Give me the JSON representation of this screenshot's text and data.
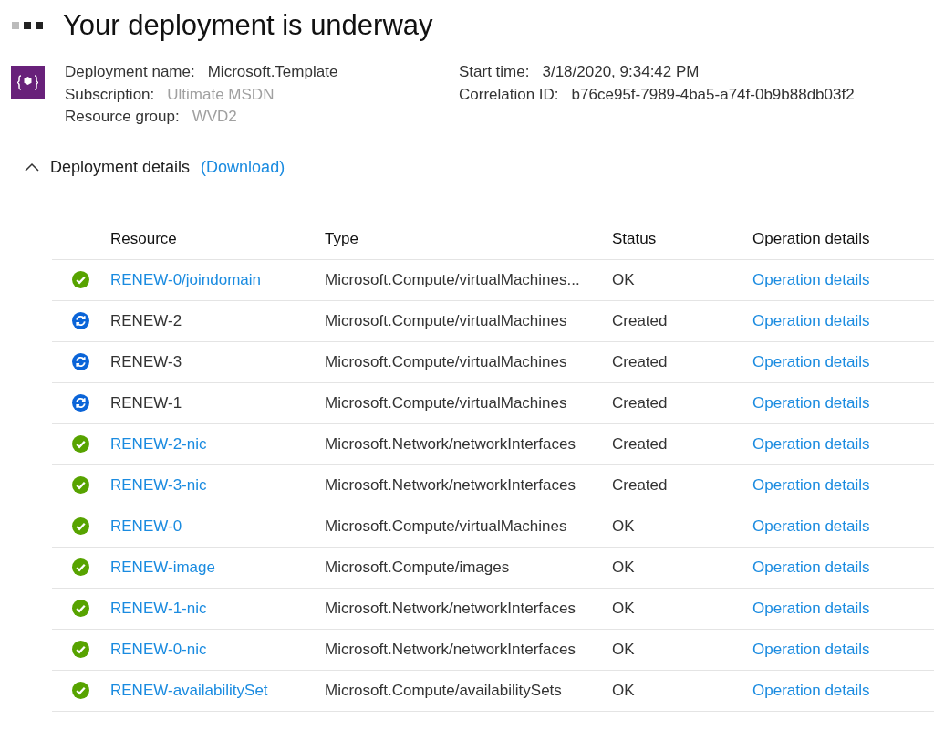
{
  "header": {
    "title": "Your deployment is underway"
  },
  "info_left": [
    {
      "label": "Deployment name:",
      "value": "Microsoft.Template",
      "muted": false
    },
    {
      "label": "Subscription:",
      "value": "Ultimate MSDN",
      "muted": true
    },
    {
      "label": "Resource group:",
      "value": "WVD2",
      "muted": true
    }
  ],
  "info_right": [
    {
      "label": "Start time:",
      "value": "3/18/2020, 9:34:42 PM"
    },
    {
      "label": "Correlation ID:",
      "value": "b76ce95f-7989-4ba5-a74f-0b9b88db03f2"
    }
  ],
  "details": {
    "title": "Deployment details",
    "link": "(Download)",
    "expanded": true
  },
  "table": {
    "columns": [
      "Resource",
      "Type",
      "Status",
      "Operation details"
    ],
    "rows": [
      {
        "kind": "done",
        "resource": "RENEW-0/joindomain",
        "type": "Microsoft.Compute/virtualMachines...",
        "status": "OK",
        "operation": "Operation details"
      },
      {
        "kind": "running",
        "resource": "RENEW-2",
        "type": "Microsoft.Compute/virtualMachines",
        "status": "Created",
        "operation": "Operation details"
      },
      {
        "kind": "running",
        "resource": "RENEW-3",
        "type": "Microsoft.Compute/virtualMachines",
        "status": "Created",
        "operation": "Operation details"
      },
      {
        "kind": "running",
        "resource": "RENEW-1",
        "type": "Microsoft.Compute/virtualMachines",
        "status": "Created",
        "operation": "Operation details"
      },
      {
        "kind": "done",
        "resource": "RENEW-2-nic",
        "type": "Microsoft.Network/networkInterfaces",
        "status": "Created",
        "operation": "Operation details"
      },
      {
        "kind": "done",
        "resource": "RENEW-3-nic",
        "type": "Microsoft.Network/networkInterfaces",
        "status": "Created",
        "operation": "Operation details"
      },
      {
        "kind": "done",
        "resource": "RENEW-0",
        "type": "Microsoft.Compute/virtualMachines",
        "status": "OK",
        "operation": "Operation details"
      },
      {
        "kind": "done",
        "resource": "RENEW-image",
        "type": "Microsoft.Compute/images",
        "status": "OK",
        "operation": "Operation details"
      },
      {
        "kind": "done",
        "resource": "RENEW-1-nic",
        "type": "Microsoft.Network/networkInterfaces",
        "status": "OK",
        "operation": "Operation details"
      },
      {
        "kind": "done",
        "resource": "RENEW-0-nic",
        "type": "Microsoft.Network/networkInterfaces",
        "status": "OK",
        "operation": "Operation details"
      },
      {
        "kind": "done",
        "resource": "RENEW-availabilitySet",
        "type": "Microsoft.Compute/availabilitySets",
        "status": "OK",
        "operation": "Operation details"
      }
    ]
  }
}
